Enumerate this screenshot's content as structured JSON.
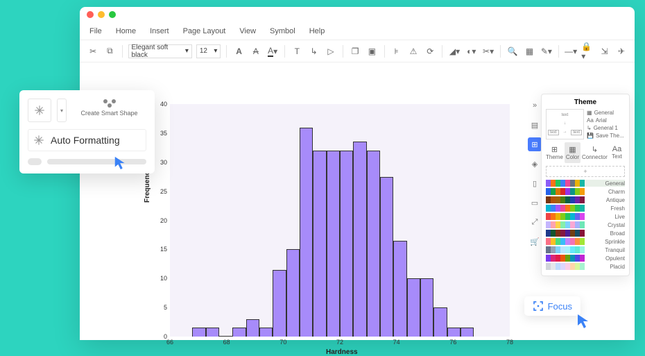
{
  "menubar": [
    "File",
    "Home",
    "Insert",
    "Page Layout",
    "View",
    "Symbol",
    "Help"
  ],
  "toolbar": {
    "font": "Elegant soft black",
    "size": "12"
  },
  "chart_data": {
    "type": "bar",
    "title": "",
    "xlabel": "Hardness",
    "ylabel": "Frequency",
    "xlim": [
      66,
      78
    ],
    "ylim": [
      0,
      40
    ],
    "yticks": [
      0,
      5,
      10,
      15,
      20,
      25,
      30,
      35,
      40
    ],
    "xticks": [
      66,
      68,
      70,
      72,
      74,
      76,
      78
    ],
    "bin_width": 0.5,
    "bins_start_at": 66.5,
    "values": [
      1.5,
      1.5,
      0,
      1.5,
      3,
      1.5,
      11.5,
      15,
      36,
      32,
      32,
      32,
      33.5,
      32,
      27.5,
      16.5,
      10,
      10,
      5,
      1.5,
      1.5
    ]
  },
  "float_panel": {
    "smart_shape_label": "Create Smart Shape",
    "auto_format_label": "Auto Formatting"
  },
  "theme_panel": {
    "title": "Theme",
    "meta": {
      "general": "General",
      "font": "Arial",
      "style": "General 1",
      "save": "Save The..."
    },
    "tabs": [
      "Theme",
      "Color",
      "Connector",
      "Text"
    ],
    "active_tab": 1,
    "palettes": [
      {
        "name": "General",
        "colors": [
          "#8b5cf6",
          "#f97316",
          "#22c55e",
          "#3b82f6",
          "#ec4899",
          "#6b7280",
          "#eab308",
          "#14b8a6"
        ],
        "active": true
      },
      {
        "name": "Charm",
        "colors": [
          "#2563eb",
          "#16a34a",
          "#d97706",
          "#dc2626",
          "#9333ea",
          "#0d9488",
          "#84cc16",
          "#f59e0b"
        ]
      },
      {
        "name": "Antique",
        "colors": [
          "#78350f",
          "#b45309",
          "#a16207",
          "#4d7c0f",
          "#065f46",
          "#1e40af",
          "#6b21a8",
          "#831843"
        ]
      },
      {
        "name": "Fresh",
        "colors": [
          "#06b6d4",
          "#3b82f6",
          "#a855f7",
          "#ec4899",
          "#f97316",
          "#84cc16",
          "#22c55e",
          "#14b8a6"
        ]
      },
      {
        "name": "Live",
        "colors": [
          "#ef4444",
          "#f97316",
          "#eab308",
          "#84cc16",
          "#22c55e",
          "#06b6d4",
          "#6366f1",
          "#d946ef"
        ]
      },
      {
        "name": "Crystal",
        "colors": [
          "#c4b5fd",
          "#fda4af",
          "#fcd34d",
          "#86efac",
          "#7dd3fc",
          "#f9a8d4",
          "#a5b4fc",
          "#6ee7b7"
        ]
      },
      {
        "name": "Broad",
        "colors": [
          "#1e3a8a",
          "#14532d",
          "#7c2d12",
          "#831843",
          "#4c1d95",
          "#713f12",
          "#164e63",
          "#881337"
        ]
      },
      {
        "name": "Sprinkle",
        "colors": [
          "#fb7185",
          "#fbbf24",
          "#4ade80",
          "#38bdf8",
          "#c084fc",
          "#f472b6",
          "#fb923c",
          "#a3e635"
        ]
      },
      {
        "name": "Tranquil",
        "colors": [
          "#64748b",
          "#94a3b8",
          "#7dd3fc",
          "#bae6fd",
          "#a5f3fc",
          "#67e8f9",
          "#5eead4",
          "#99f6e4"
        ]
      },
      {
        "name": "Opulent",
        "colors": [
          "#7c3aed",
          "#db2777",
          "#e11d48",
          "#ea580c",
          "#65a30d",
          "#0891b2",
          "#4f46e5",
          "#c026d3"
        ]
      },
      {
        "name": "Placid",
        "colors": [
          "#d1d5db",
          "#e5e7eb",
          "#bfdbfe",
          "#ddd6fe",
          "#fbcfe8",
          "#fed7aa",
          "#d9f99d",
          "#a7f3d0"
        ]
      }
    ]
  },
  "focus": {
    "label": "Focus"
  }
}
